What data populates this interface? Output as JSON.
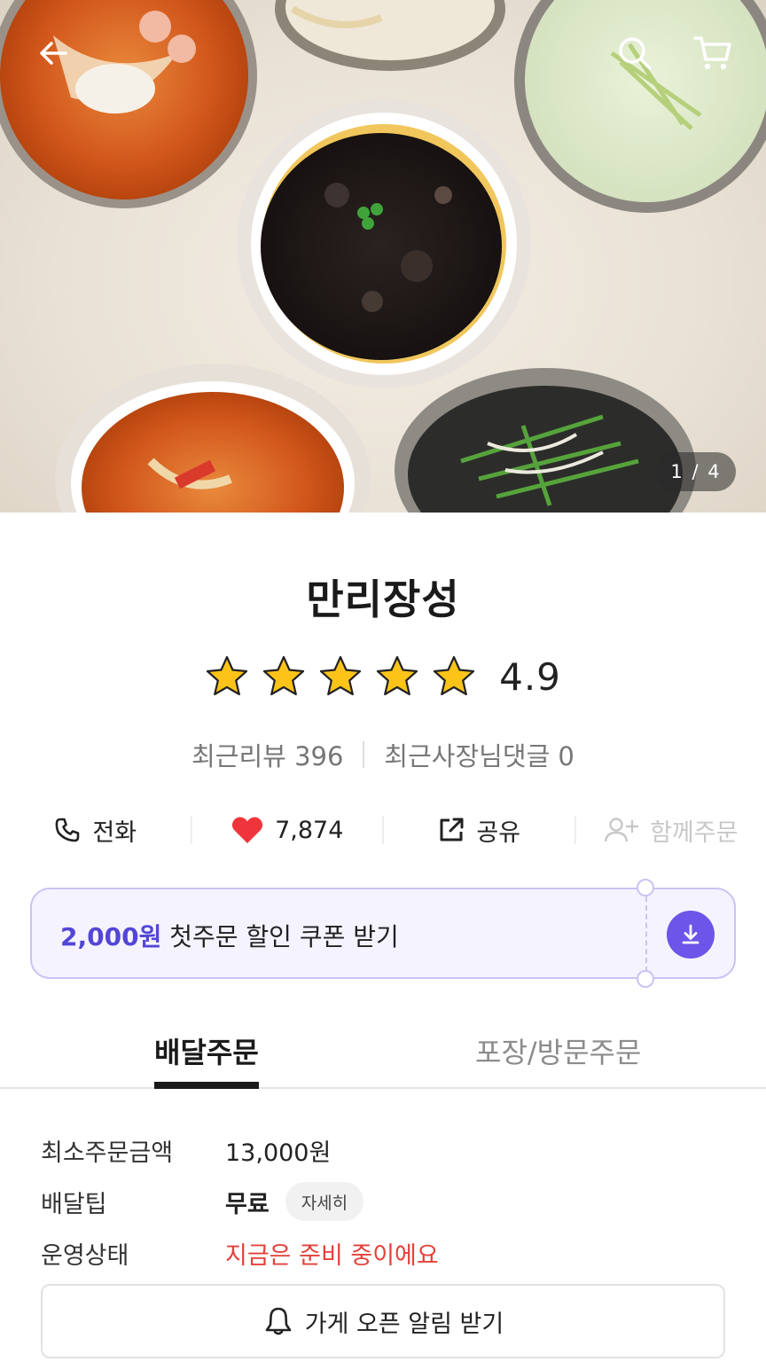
{
  "hero": {
    "image_counter": "1 / 4",
    "icons": {
      "back": "arrow-left-icon",
      "search": "search-icon",
      "cart": "cart-icon"
    }
  },
  "store": {
    "name": "만리장성",
    "rating": "4.9",
    "rating_stars": 5,
    "recent_reviews_label": "최근리뷰 396",
    "owner_replies_label": "최근사장님댓글 0"
  },
  "actions": {
    "call": "전화",
    "likes": "7,874",
    "share": "공유",
    "group_order": "함께주문"
  },
  "coupon": {
    "amount": "2,000원",
    "text": " 첫주문 할인 쿠폰 받기",
    "accent_color": "#5346d6"
  },
  "tabs": {
    "delivery": "배달주문",
    "pickup": "포장/방문주문",
    "active": "delivery"
  },
  "info": {
    "min_order_label": "최소주문금액",
    "min_order_value": "13,000원",
    "delivery_tip_label": "배달팁",
    "delivery_tip_value": "무료",
    "detail_chip": "자세히",
    "status_label": "운영상태",
    "status_value": "지금은 준비 중이에요",
    "status_color": "#e3413a"
  },
  "notify_button": "가게 오픈 알림 받기"
}
